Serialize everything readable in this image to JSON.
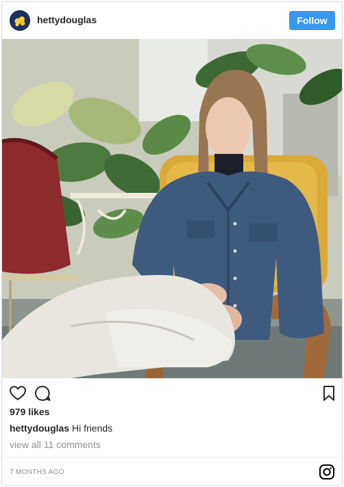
{
  "post": {
    "username": "hettydouglas",
    "follow_label": "Follow",
    "likes_text": "979 likes",
    "caption_user": "hettydouglas",
    "caption_text": "Hi friends",
    "comments_link": "view all 11 comments",
    "timestamp": "7 MONTHS AGO"
  },
  "colors": {
    "accent": "#3897f0",
    "text": "#262626",
    "muted": "#8e8e8e",
    "border": "#dbdbdb"
  },
  "icons": {
    "like": "heart-icon",
    "comment": "comment-icon",
    "save": "bookmark-icon",
    "brand": "instagram-icon"
  }
}
